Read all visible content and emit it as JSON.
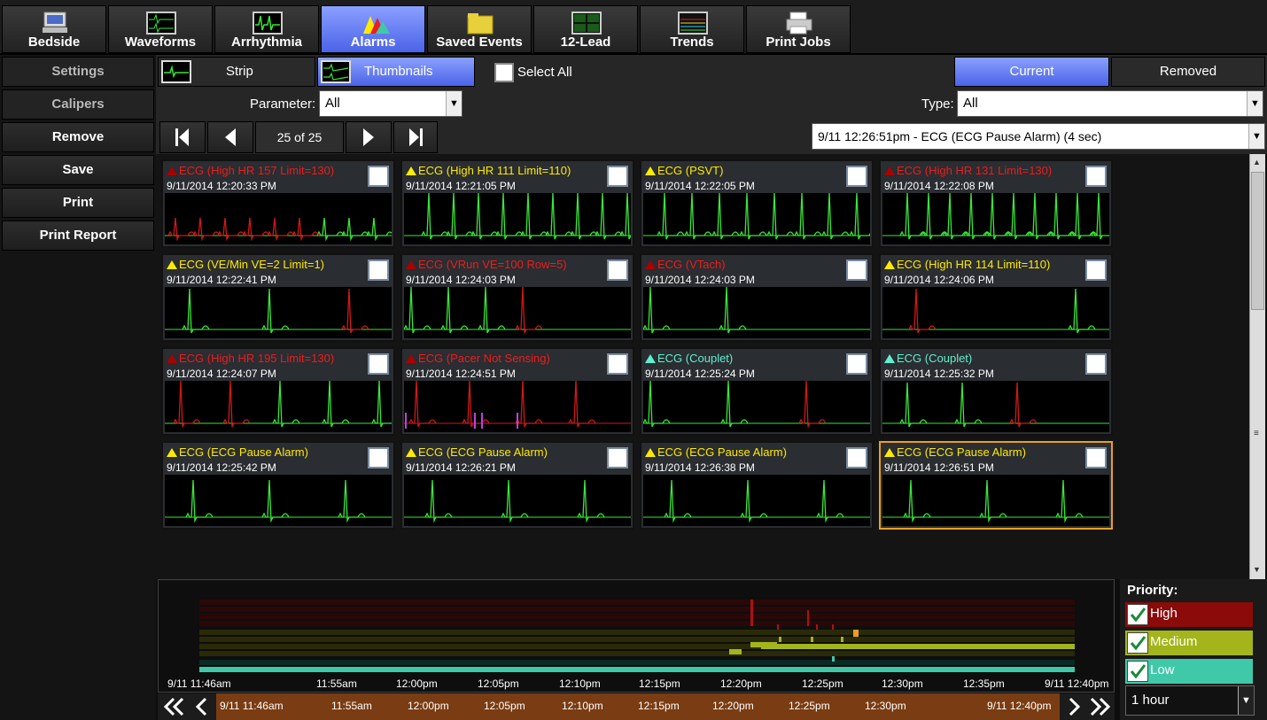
{
  "nav": {
    "tabs": [
      {
        "label": "Bedside",
        "icon": "bedside-monitor-icon"
      },
      {
        "label": "Waveforms",
        "icon": "waveforms-icon"
      },
      {
        "label": "Arrhythmia",
        "icon": "arrhythmia-icon"
      },
      {
        "label": "Alarms",
        "icon": "alarms-icon",
        "active": true
      },
      {
        "label": "Saved Events",
        "icon": "folder-icon"
      },
      {
        "label": "12-Lead",
        "icon": "twelve-lead-icon"
      },
      {
        "label": "Trends",
        "icon": "trends-icon"
      },
      {
        "label": "Print Jobs",
        "icon": "printer-icon"
      }
    ]
  },
  "left": {
    "settings": "Settings",
    "calipers": "Calipers",
    "remove": "Remove",
    "save": "Save",
    "print": "Print",
    "print_report": "Print Report"
  },
  "toolbar": {
    "strip": "Strip",
    "thumbnails": "Thumbnails",
    "select_all": "Select All",
    "current": "Current",
    "removed": "Removed",
    "parameter_label": "Parameter:",
    "parameter_value": "All",
    "type_label": "Type:",
    "type_value": "All",
    "page_indicator": "25 of 25",
    "event_select": "9/11 12:26:51pm - ECG (ECG Pause Alarm) (4 sec)"
  },
  "events": [
    {
      "title": "ECG (High HR  157  Limit=130)",
      "time": "9/11/2014 12:20:33 PM",
      "priority": "high"
    },
    {
      "title": "ECG (High HR  111  Limit=110)",
      "time": "9/11/2014 12:21:05 PM",
      "priority": "med"
    },
    {
      "title": "ECG (PSVT)",
      "time": "9/11/2014 12:22:05 PM",
      "priority": "med"
    },
    {
      "title": "ECG (High HR  131  Limit=130)",
      "time": "9/11/2014 12:22:08 PM",
      "priority": "high"
    },
    {
      "title": "ECG (VE/Min  VE=2  Limit=1)",
      "time": "9/11/2014 12:22:41 PM",
      "priority": "med"
    },
    {
      "title": "ECG (VRun  VE=100  Row=5)",
      "time": "9/11/2014 12:24:03 PM",
      "priority": "high"
    },
    {
      "title": "ECG (VTach)",
      "time": "9/11/2014 12:24:03 PM",
      "priority": "high"
    },
    {
      "title": "ECG (High HR  114  Limit=110)",
      "time": "9/11/2014 12:24:06 PM",
      "priority": "med"
    },
    {
      "title": "ECG (High HR  195  Limit=130)",
      "time": "9/11/2014 12:24:07 PM",
      "priority": "high"
    },
    {
      "title": "ECG (Pacer Not Sensing)",
      "time": "9/11/2014 12:24:51 PM",
      "priority": "high"
    },
    {
      "title": "ECG (Couplet)",
      "time": "9/11/2014 12:25:24 PM",
      "priority": "low"
    },
    {
      "title": "ECG (Couplet)",
      "time": "9/11/2014 12:25:32 PM",
      "priority": "low"
    },
    {
      "title": "ECG (ECG Pause Alarm)",
      "time": "9/11/2014 12:25:42 PM",
      "priority": "med"
    },
    {
      "title": "ECG (ECG Pause Alarm)",
      "time": "9/11/2014 12:26:21 PM",
      "priority": "med"
    },
    {
      "title": "ECG (ECG Pause Alarm)",
      "time": "9/11/2014 12:26:38 PM",
      "priority": "med"
    },
    {
      "title": "ECG (ECG Pause Alarm)",
      "time": "9/11/2014 12:26:51 PM",
      "priority": "med",
      "selected": true
    }
  ],
  "timeline": {
    "start": "9/11 11:46am",
    "end": "9/11 12:40pm",
    "ticks": [
      "11:55am",
      "12:00pm",
      "12:05pm",
      "12:10pm",
      "12:15pm",
      "12:20pm",
      "12:25pm",
      "12:30pm",
      "12:35pm"
    ],
    "nav_start": "9/11 11:46am",
    "nav_end": "9/11 12:40pm",
    "nav_ticks": [
      "11:55am",
      "12:00pm",
      "12:05pm",
      "12:10pm",
      "12:15pm",
      "12:20pm",
      "12:25pm",
      "12:30pm"
    ]
  },
  "priority": {
    "title": "Priority:",
    "items": [
      {
        "label": "High",
        "color": "#8b0a0a",
        "checked": true
      },
      {
        "label": "Medium",
        "color": "#a3b51a",
        "checked": true
      },
      {
        "label": "Low",
        "color": "#3fc9a8",
        "checked": true
      }
    ],
    "range": "1 hour"
  },
  "colors": {
    "accent": "#5b73f0",
    "wave_green": "#39e639",
    "wave_red": "#d01818",
    "selected_border": "#e8a020"
  }
}
